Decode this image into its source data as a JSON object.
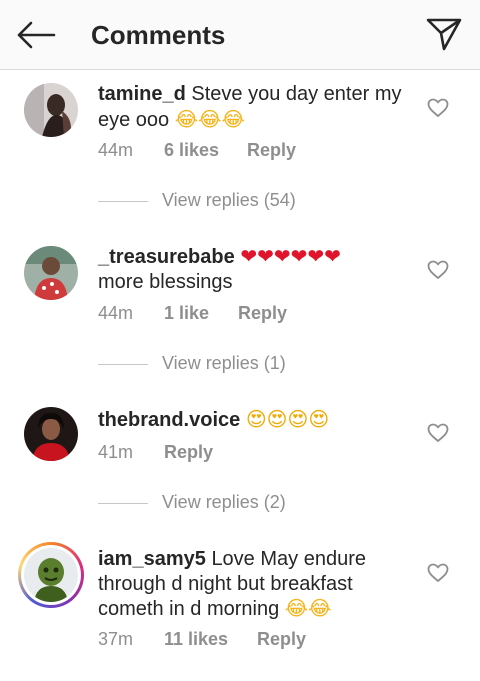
{
  "header": {
    "title": "Comments",
    "back_icon": "back-arrow-icon",
    "send_icon": "send-icon"
  },
  "comments": [
    {
      "username": "tamine_d",
      "text": "Steve you day enter my eye ooo",
      "emojis": "😂😂😂",
      "time": "44m",
      "likes": "6 likes",
      "reply": "Reply",
      "view_replies": "View replies (54)"
    },
    {
      "username": "_treasurebabe",
      "emojis": "❤❤❤❤❤❤",
      "text": "more blessings",
      "time": "44m",
      "likes": "1 like",
      "reply": "Reply",
      "view_replies": "View replies (1)"
    },
    {
      "username": "thebrand.voice",
      "emojis": "😍😍😍😍",
      "time": "41m",
      "reply": "Reply",
      "view_replies": "View replies (2)"
    },
    {
      "username": "iam_samy5",
      "text": "Love May endure through d night but breakfast cometh in d morning",
      "emojis": "😂😂",
      "time": "37m",
      "likes": "11 likes",
      "reply": "Reply"
    }
  ],
  "colors": {
    "text": "#262626",
    "secondary": "#8e8e8e",
    "divider": "#dbdbdb",
    "heart": "#e0142b"
  }
}
